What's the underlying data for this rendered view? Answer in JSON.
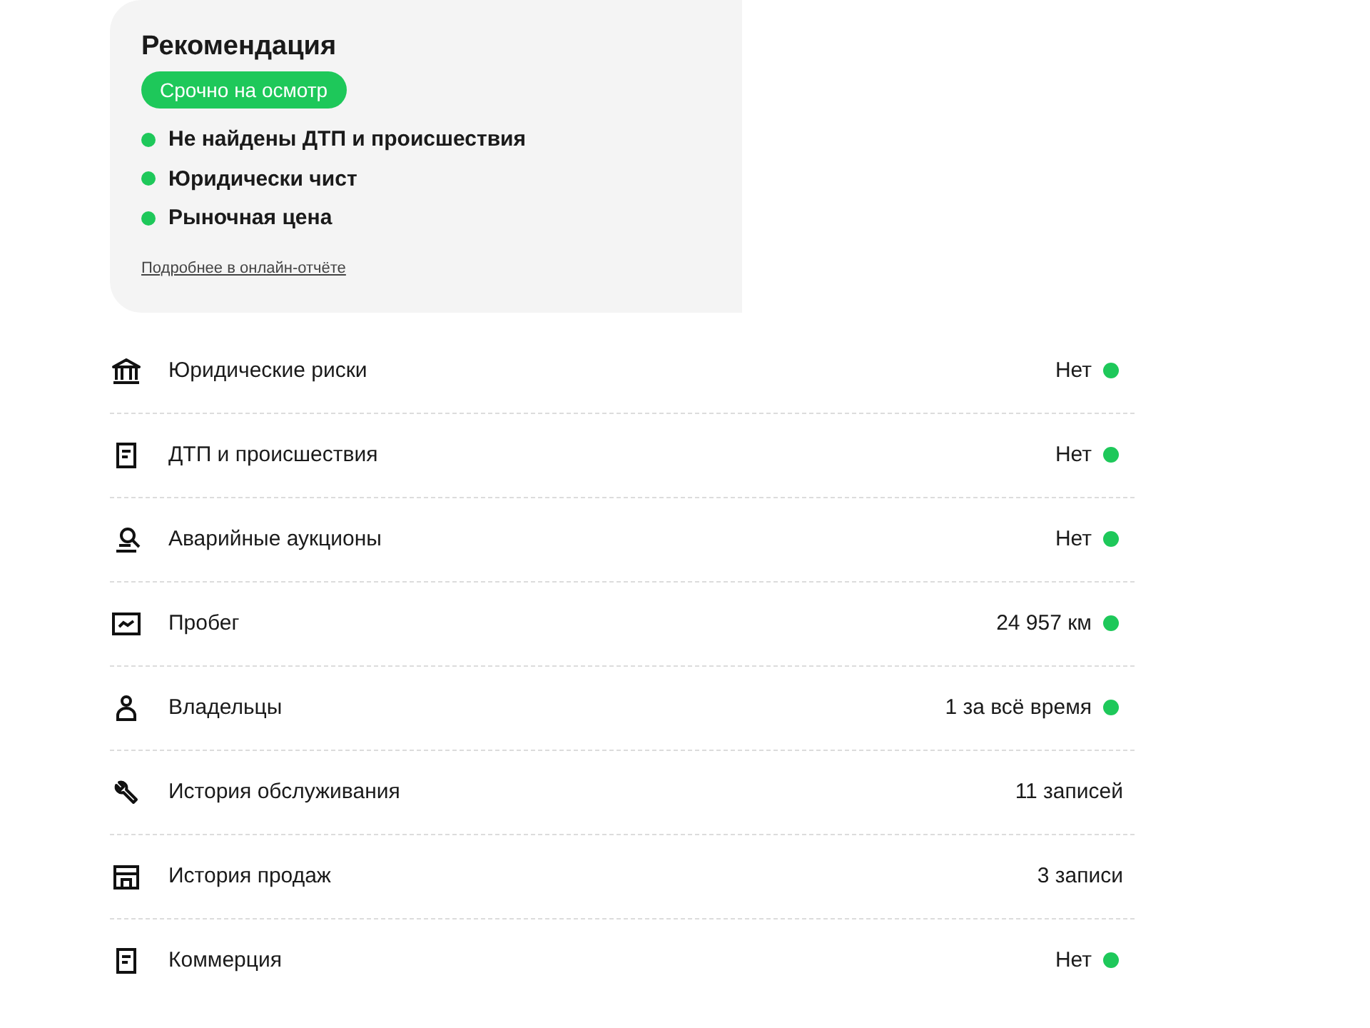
{
  "recommendation": {
    "title": "Рекомендация",
    "badge": "Срочно на осмотр",
    "points": [
      {
        "text": "Не найдены ДТП и происшествия",
        "color": "#1ec85a"
      },
      {
        "text": "Юридически чист",
        "color": "#1ec85a"
      },
      {
        "text": "Рыночная цена",
        "color": "#1ec85a"
      }
    ],
    "link": "Подробнее в онлайн-отчёте"
  },
  "rows": [
    {
      "kind": "bank",
      "label": "Юридические риски",
      "value": "Нет",
      "dot": true
    },
    {
      "kind": "doc",
      "label": "ДТП и происшествия",
      "value": "Нет",
      "dot": true
    },
    {
      "kind": "gavel",
      "label": "Аварийные аукционы",
      "value": "Нет",
      "dot": true
    },
    {
      "kind": "chart",
      "label": "Пробег",
      "value": "24 957 км",
      "dot": true
    },
    {
      "kind": "person",
      "label": "Владельцы",
      "value": "1 за всё время",
      "dot": true
    },
    {
      "kind": "wrench",
      "label": "История обслуживания",
      "value": "11 записей",
      "dot": false
    },
    {
      "kind": "store",
      "label": "История продаж",
      "value": "3 записи",
      "dot": false
    },
    {
      "kind": "doc",
      "label": "Коммерция",
      "value": "Нет",
      "dot": true
    }
  ]
}
